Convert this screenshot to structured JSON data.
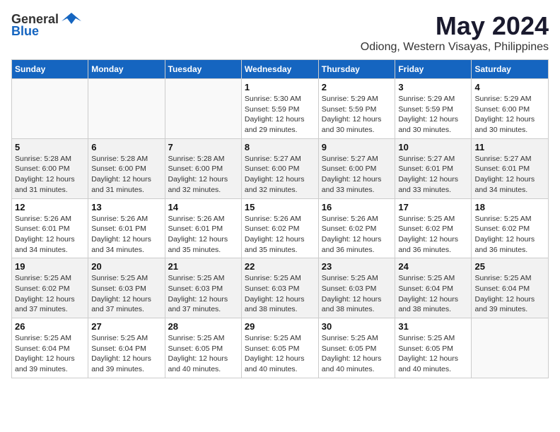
{
  "logo": {
    "general": "General",
    "blue": "Blue"
  },
  "header": {
    "month": "May 2024",
    "location": "Odiong, Western Visayas, Philippines"
  },
  "weekdays": [
    "Sunday",
    "Monday",
    "Tuesday",
    "Wednesday",
    "Thursday",
    "Friday",
    "Saturday"
  ],
  "weeks": [
    [
      {
        "day": "",
        "sunrise": "",
        "sunset": "",
        "daylight": ""
      },
      {
        "day": "",
        "sunrise": "",
        "sunset": "",
        "daylight": ""
      },
      {
        "day": "",
        "sunrise": "",
        "sunset": "",
        "daylight": ""
      },
      {
        "day": "1",
        "sunrise": "Sunrise: 5:30 AM",
        "sunset": "Sunset: 5:59 PM",
        "daylight": "Daylight: 12 hours and 29 minutes."
      },
      {
        "day": "2",
        "sunrise": "Sunrise: 5:29 AM",
        "sunset": "Sunset: 5:59 PM",
        "daylight": "Daylight: 12 hours and 30 minutes."
      },
      {
        "day": "3",
        "sunrise": "Sunrise: 5:29 AM",
        "sunset": "Sunset: 5:59 PM",
        "daylight": "Daylight: 12 hours and 30 minutes."
      },
      {
        "day": "4",
        "sunrise": "Sunrise: 5:29 AM",
        "sunset": "Sunset: 6:00 PM",
        "daylight": "Daylight: 12 hours and 30 minutes."
      }
    ],
    [
      {
        "day": "5",
        "sunrise": "Sunrise: 5:28 AM",
        "sunset": "Sunset: 6:00 PM",
        "daylight": "Daylight: 12 hours and 31 minutes."
      },
      {
        "day": "6",
        "sunrise": "Sunrise: 5:28 AM",
        "sunset": "Sunset: 6:00 PM",
        "daylight": "Daylight: 12 hours and 31 minutes."
      },
      {
        "day": "7",
        "sunrise": "Sunrise: 5:28 AM",
        "sunset": "Sunset: 6:00 PM",
        "daylight": "Daylight: 12 hours and 32 minutes."
      },
      {
        "day": "8",
        "sunrise": "Sunrise: 5:27 AM",
        "sunset": "Sunset: 6:00 PM",
        "daylight": "Daylight: 12 hours and 32 minutes."
      },
      {
        "day": "9",
        "sunrise": "Sunrise: 5:27 AM",
        "sunset": "Sunset: 6:00 PM",
        "daylight": "Daylight: 12 hours and 33 minutes."
      },
      {
        "day": "10",
        "sunrise": "Sunrise: 5:27 AM",
        "sunset": "Sunset: 6:01 PM",
        "daylight": "Daylight: 12 hours and 33 minutes."
      },
      {
        "day": "11",
        "sunrise": "Sunrise: 5:27 AM",
        "sunset": "Sunset: 6:01 PM",
        "daylight": "Daylight: 12 hours and 34 minutes."
      }
    ],
    [
      {
        "day": "12",
        "sunrise": "Sunrise: 5:26 AM",
        "sunset": "Sunset: 6:01 PM",
        "daylight": "Daylight: 12 hours and 34 minutes."
      },
      {
        "day": "13",
        "sunrise": "Sunrise: 5:26 AM",
        "sunset": "Sunset: 6:01 PM",
        "daylight": "Daylight: 12 hours and 34 minutes."
      },
      {
        "day": "14",
        "sunrise": "Sunrise: 5:26 AM",
        "sunset": "Sunset: 6:01 PM",
        "daylight": "Daylight: 12 hours and 35 minutes."
      },
      {
        "day": "15",
        "sunrise": "Sunrise: 5:26 AM",
        "sunset": "Sunset: 6:02 PM",
        "daylight": "Daylight: 12 hours and 35 minutes."
      },
      {
        "day": "16",
        "sunrise": "Sunrise: 5:26 AM",
        "sunset": "Sunset: 6:02 PM",
        "daylight": "Daylight: 12 hours and 36 minutes."
      },
      {
        "day": "17",
        "sunrise": "Sunrise: 5:25 AM",
        "sunset": "Sunset: 6:02 PM",
        "daylight": "Daylight: 12 hours and 36 minutes."
      },
      {
        "day": "18",
        "sunrise": "Sunrise: 5:25 AM",
        "sunset": "Sunset: 6:02 PM",
        "daylight": "Daylight: 12 hours and 36 minutes."
      }
    ],
    [
      {
        "day": "19",
        "sunrise": "Sunrise: 5:25 AM",
        "sunset": "Sunset: 6:02 PM",
        "daylight": "Daylight: 12 hours and 37 minutes."
      },
      {
        "day": "20",
        "sunrise": "Sunrise: 5:25 AM",
        "sunset": "Sunset: 6:03 PM",
        "daylight": "Daylight: 12 hours and 37 minutes."
      },
      {
        "day": "21",
        "sunrise": "Sunrise: 5:25 AM",
        "sunset": "Sunset: 6:03 PM",
        "daylight": "Daylight: 12 hours and 37 minutes."
      },
      {
        "day": "22",
        "sunrise": "Sunrise: 5:25 AM",
        "sunset": "Sunset: 6:03 PM",
        "daylight": "Daylight: 12 hours and 38 minutes."
      },
      {
        "day": "23",
        "sunrise": "Sunrise: 5:25 AM",
        "sunset": "Sunset: 6:03 PM",
        "daylight": "Daylight: 12 hours and 38 minutes."
      },
      {
        "day": "24",
        "sunrise": "Sunrise: 5:25 AM",
        "sunset": "Sunset: 6:04 PM",
        "daylight": "Daylight: 12 hours and 38 minutes."
      },
      {
        "day": "25",
        "sunrise": "Sunrise: 5:25 AM",
        "sunset": "Sunset: 6:04 PM",
        "daylight": "Daylight: 12 hours and 39 minutes."
      }
    ],
    [
      {
        "day": "26",
        "sunrise": "Sunrise: 5:25 AM",
        "sunset": "Sunset: 6:04 PM",
        "daylight": "Daylight: 12 hours and 39 minutes."
      },
      {
        "day": "27",
        "sunrise": "Sunrise: 5:25 AM",
        "sunset": "Sunset: 6:04 PM",
        "daylight": "Daylight: 12 hours and 39 minutes."
      },
      {
        "day": "28",
        "sunrise": "Sunrise: 5:25 AM",
        "sunset": "Sunset: 6:05 PM",
        "daylight": "Daylight: 12 hours and 40 minutes."
      },
      {
        "day": "29",
        "sunrise": "Sunrise: 5:25 AM",
        "sunset": "Sunset: 6:05 PM",
        "daylight": "Daylight: 12 hours and 40 minutes."
      },
      {
        "day": "30",
        "sunrise": "Sunrise: 5:25 AM",
        "sunset": "Sunset: 6:05 PM",
        "daylight": "Daylight: 12 hours and 40 minutes."
      },
      {
        "day": "31",
        "sunrise": "Sunrise: 5:25 AM",
        "sunset": "Sunset: 6:05 PM",
        "daylight": "Daylight: 12 hours and 40 minutes."
      },
      {
        "day": "",
        "sunrise": "",
        "sunset": "",
        "daylight": ""
      }
    ]
  ]
}
